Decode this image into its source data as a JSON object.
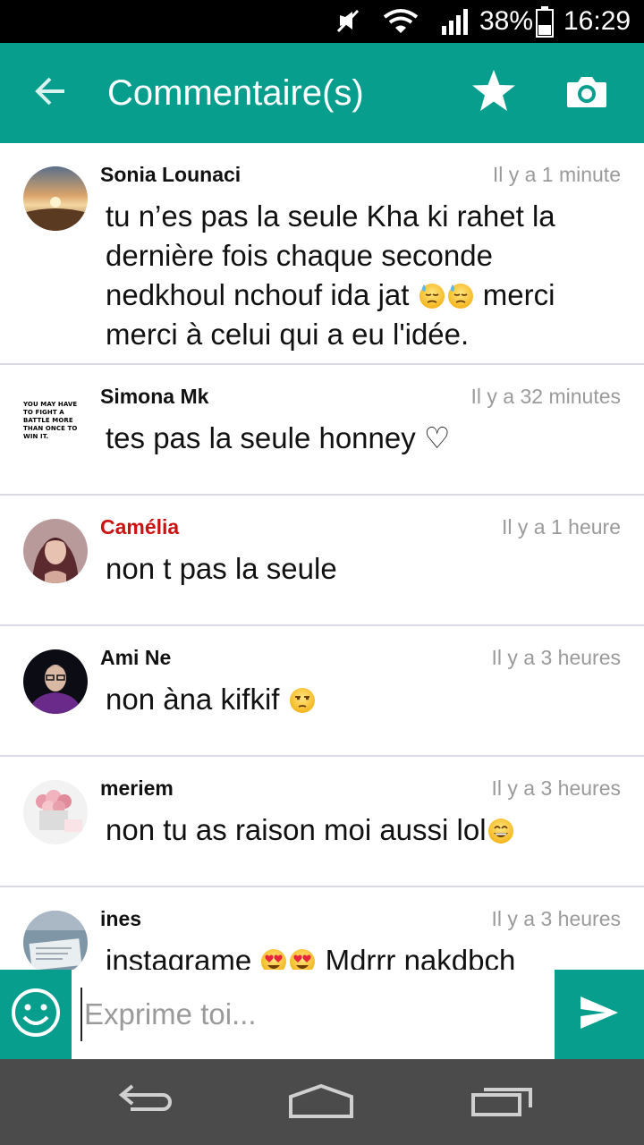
{
  "status_bar": {
    "battery_text": "38%",
    "time": "16:29",
    "icons": [
      "mute-icon",
      "wifi-icon",
      "signal-icon",
      "battery-icon"
    ]
  },
  "app_bar": {
    "title": "Commentaire(s)",
    "icons": [
      "back-arrow-icon",
      "star-icon",
      "camera-icon"
    ],
    "color": "#079e8d"
  },
  "comments": [
    {
      "author": "Sonia Lounaci",
      "time": "Il y a 1 minute",
      "text_parts": [
        "tu n’es pas la seule Kha ki rahet la dernière fois chaque seconde nedkhoul nchouf ida jat ",
        "merci merci à celui qui a eu l'idée."
      ],
      "emojis": [
        "downcast-sweat-emoji",
        "downcast-sweat-emoji"
      ]
    },
    {
      "author": "Simona Mk",
      "time": "Il y a 32 minutes",
      "text": "tes pas la seule honney ♡",
      "avatar_text": "YOU MAY HAVE TO FIGHT A BATTLE MORE THAN ONCE TO WIN IT."
    },
    {
      "author": "Camélia",
      "time": "Il y a 1 heure",
      "text": "non t pas la seule",
      "author_color": "#cc1111"
    },
    {
      "author": "Ami Ne",
      "time": "Il y a 3 heures",
      "text": "non àna kifkif",
      "emojis": [
        "unamused-emoji"
      ]
    },
    {
      "author": "meriem",
      "time": "Il y a 3 heures",
      "text": "non tu as raison moi aussi lol",
      "emojis": [
        "grinning-emoji"
      ]
    },
    {
      "author": "ines",
      "time": "Il y a 3 heures",
      "text_parts": [
        "instagrame ",
        " Mdrrr  nakdbch"
      ],
      "emojis": [
        "heart-eyes-emoji",
        "heart-eyes-emoji"
      ]
    }
  ],
  "composer": {
    "placeholder": "Exprime toi...",
    "icons": [
      "smiley-icon",
      "send-icon"
    ]
  },
  "nav_bar": {
    "icons": [
      "nav-back-icon",
      "nav-home-icon",
      "nav-recents-icon"
    ]
  }
}
